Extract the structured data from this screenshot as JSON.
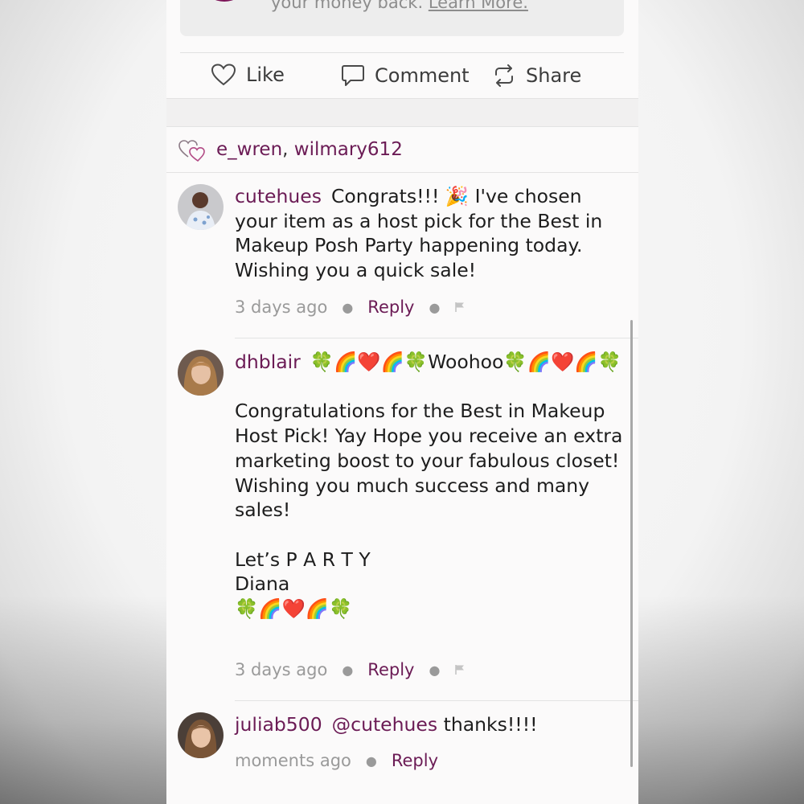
{
  "promo": {
    "text": "your money back.",
    "link": "Learn More."
  },
  "actions": {
    "like": "Like",
    "comment": "Comment",
    "share": "Share"
  },
  "likers": {
    "icon": "hearts-icon",
    "user1": "e_wren",
    "separator": ",",
    "user2": "wilmary612"
  },
  "comments": [
    {
      "user": "cutehues",
      "text": "Congrats!!! 🎉 I've chosen your item as a host pick for the Best in Makeup Posh Party happening today. Wishing you a quick sale!",
      "time": "3 days ago",
      "reply": "Reply"
    },
    {
      "user": "dhblair",
      "text": "🍀🌈❤️🌈🍀Woohoo🍀🌈❤️🌈🍀\n\nCongratulations for the Best in Makeup Host Pick! Yay Hope you receive an extra marketing boost to your fabulous closet! Wishing you much success and many sales!\n\nLet’s P A R T Y\nDiana\n🍀🌈❤️🌈🍀",
      "time": "3 days ago",
      "reply": "Reply"
    },
    {
      "user": "juliab500",
      "mention": "@cutehues",
      "text": " thanks!!!!",
      "time": "moments ago",
      "reply": "Reply"
    }
  ],
  "colors": {
    "accent": "#6b1b55",
    "muted": "#9a9a9a"
  }
}
